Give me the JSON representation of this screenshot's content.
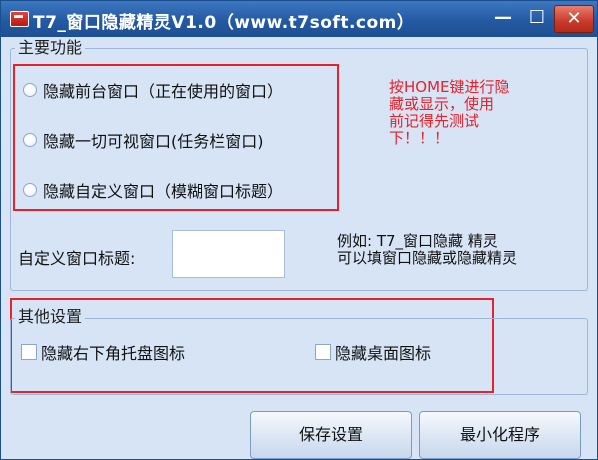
{
  "window": {
    "title": "T7_窗口隐藏精灵V1.0（www.t7soft.com）",
    "controls": {
      "minimize": "—",
      "maximize": "☐",
      "close": "✕"
    }
  },
  "main_group": {
    "title": "主要功能",
    "options": [
      {
        "label": "隐藏前台窗口（正在使用的窗口）",
        "selected": false
      },
      {
        "label": "隐藏一切可视窗口(任务栏窗口)",
        "selected": false
      },
      {
        "label": "隐藏自定义窗口（模糊窗口标题）",
        "selected": false
      }
    ],
    "hint_lines": [
      "按HOME键进行隐",
      "藏或显示，使用",
      "前记得先测试",
      "下！！！"
    ],
    "hint_color": "#e8212a",
    "custom_title_label": "自定义窗口标题:",
    "custom_title_value": "",
    "example_lines": [
      "例如: T7_窗口隐藏  精灵",
      "可以填窗口隐藏或隐藏精灵"
    ]
  },
  "other_group": {
    "title": "其他设置",
    "options": [
      {
        "label": "隐藏右下角托盘图标",
        "checked": false
      },
      {
        "label": "隐藏桌面图标",
        "checked": false
      }
    ]
  },
  "buttons": {
    "save": "保存设置",
    "minimize_program": "最小化程序"
  },
  "colors": {
    "titlebar": "#245aa3",
    "body": "#d6e4f5",
    "highlight_box": "#e8212a"
  }
}
